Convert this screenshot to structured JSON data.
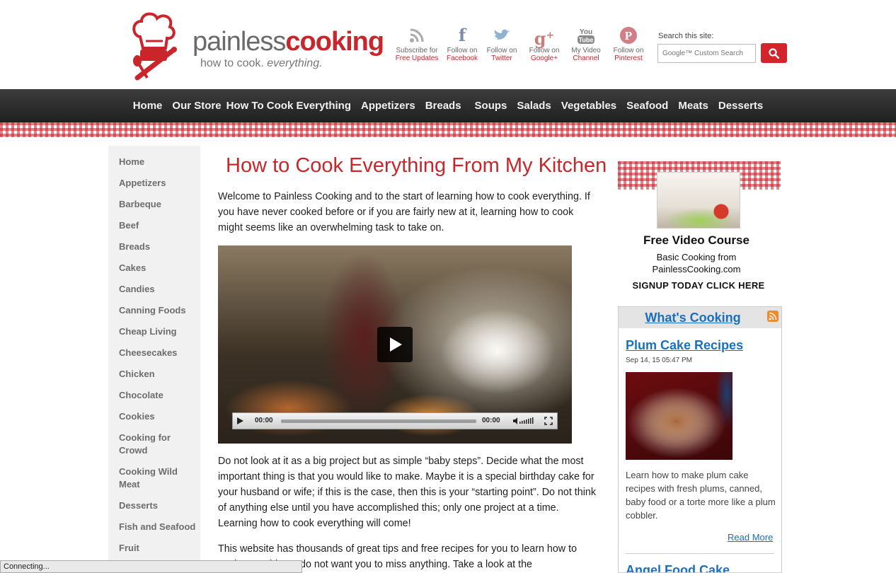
{
  "header": {
    "logo_light": "painless",
    "logo_bold": "cooking",
    "tagline_prefix": "how to cook.",
    "tagline_emph": "everything.",
    "social": [
      {
        "icon": "rss-icon",
        "glyph": "◥",
        "line1": "Subscribe for",
        "line2": "Free Updates"
      },
      {
        "icon": "facebook-icon",
        "glyph": "f",
        "line1": "Follow on",
        "line2": "Facebook"
      },
      {
        "icon": "twitter-icon",
        "glyph": "❧",
        "line1": "Follow on",
        "line2": "Twitter"
      },
      {
        "icon": "google-plus-icon",
        "glyph": "g+",
        "line1": "Follow on",
        "line2": "Google+"
      },
      {
        "icon": "youtube-icon",
        "glyph": "You",
        "line1": "My Video",
        "line2": "Channel"
      },
      {
        "icon": "pinterest-icon",
        "glyph": "P",
        "line1": "Follow on",
        "line2": "Pinterest"
      }
    ],
    "search_label": "Search this site:",
    "search_placeholder": "Google™ Custom Search"
  },
  "nav": [
    "Home",
    "Our Store",
    "How To Cook Everything",
    "Appetizers",
    "Breads",
    "Soups",
    "Salads",
    "Vegetables",
    "Seafood",
    "Meats",
    "Desserts"
  ],
  "sidebar": [
    "Home",
    "Appetizers",
    "Barbeque",
    "Beef",
    "Breads",
    "Cakes",
    "Candies",
    "Canning Foods",
    "Cheap Living",
    "Cheesecakes",
    "Chicken",
    "Chocolate",
    "Cookies",
    "Cooking for Crowd",
    "Cooking Wild Meat",
    "Desserts",
    "Fish and Seafood",
    "Fruit"
  ],
  "main": {
    "title": "How to Cook Everything From My Kitchen",
    "intro": "Welcome to Painless Cooking and to the start of learning how to cook everything. If you have never cooked before or if you are fairly new at it, learning how to cook might seems like an overwhelming task to take on.",
    "video": {
      "time_current": "00:00",
      "time_total": "00:00"
    },
    "para2": "Do not look at it as a big project but as simple “baby steps”. Decide what the most important thing is that you would like to make. Maybe it is a special birthday cake for your husband or wife; if this is the case, then this is your “starting point”. Do not think of anything else until you have accomplished this; only one project at a time. Learning how to cook everything will come!",
    "para3": "This website has thousands of great tips and free recipes for you to learn how to cook everything. I do not want you to miss anything. Take a look at the"
  },
  "promo": {
    "title": "Free Video Course",
    "sub1": "Basic Cooking from",
    "sub2": "PainlessCooking.com",
    "cta": "SIGNUP TODAY CLICK HERE"
  },
  "whats_cooking": {
    "title": "What's Cooking",
    "post_title": "Plum Cake Recipes",
    "post_date": "Sep 14, 15 05:47 PM",
    "excerpt": "Learn how to make plum cake recipes with fresh plums, canned, baby food or a torte more like a plum cobbler.",
    "read_more": "Read More",
    "next_title": "Angel Food Cake"
  },
  "status": "Connecting...",
  "colors": {
    "brand_red": "#c9252b",
    "link_blue": "#1b6fbf",
    "nav_bg": "#2e2e2e"
  }
}
